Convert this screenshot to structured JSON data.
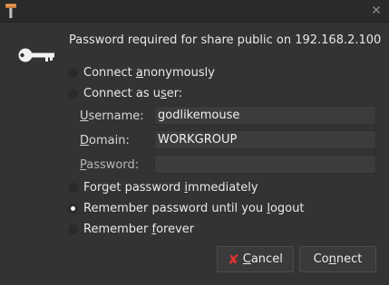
{
  "window": {
    "header": "Password required for share public on 192.168.2.100"
  },
  "options": {
    "anon_pre": "Connect ",
    "anon_u": "a",
    "anon_post": "nonymously",
    "user_pre": "Connect as u",
    "user_u": "s",
    "user_post": "er:",
    "forget_pre": "Forget password ",
    "forget_u": "i",
    "forget_post": "mmediately",
    "logout_pre": "Remember password until you ",
    "logout_u": "l",
    "logout_post": "ogout",
    "forever_pre": "Remember ",
    "forever_u": "f",
    "forever_post": "orever"
  },
  "fields": {
    "username_u": "U",
    "username_rest": "sername:",
    "username_value": "godlikemouse",
    "domain_u": "D",
    "domain_rest": "omain:",
    "domain_value": "WORKGROUP",
    "password_u": "P",
    "password_rest": "assword:",
    "password_value": ""
  },
  "buttons": {
    "cancel_u": "C",
    "cancel_rest": "ancel",
    "connect_pre": "Co",
    "connect_u": "n",
    "connect_post": "nect"
  },
  "selected_option": "logout",
  "colors": {
    "background": "#333333",
    "cancel_icon": "#e03030"
  },
  "icons": {
    "app": "tool-icon",
    "auth": "key-icon",
    "close": "close-icon",
    "cancel": "cancel-x-icon"
  }
}
